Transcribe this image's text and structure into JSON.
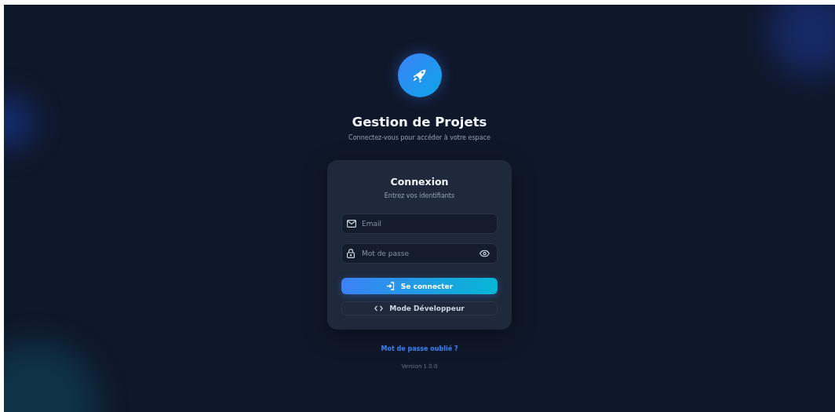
{
  "header": {
    "title": "Gestion de Projets",
    "subtitle": "Connectez-vous pour accéder à votre espace"
  },
  "card": {
    "title": "Connexion",
    "subtitle": "Entrez vos identifiants",
    "fields": [
      {
        "kind": "email",
        "placeholder": "Email"
      },
      {
        "kind": "password",
        "placeholder": "Mot de passe"
      }
    ],
    "buttons": [
      {
        "kind": "primary",
        "label": "Se connecter"
      },
      {
        "kind": "outline",
        "label": "Mode Développeur"
      }
    ]
  },
  "forgot_link": "Mot de passe oublié ?",
  "version": "Version 1.0.0"
}
